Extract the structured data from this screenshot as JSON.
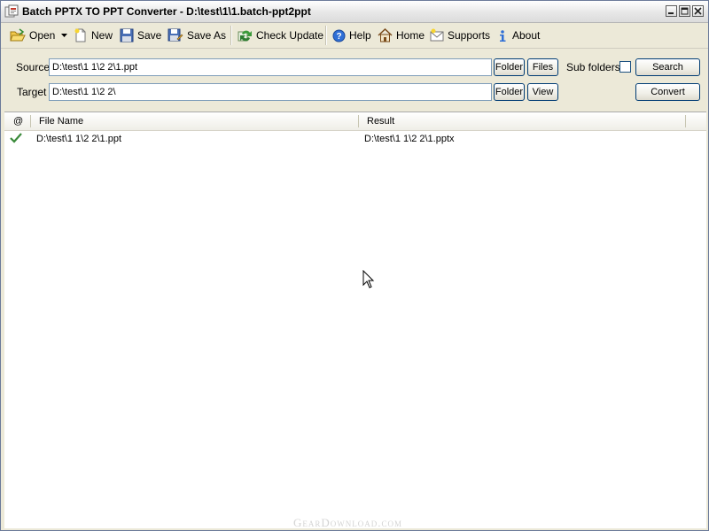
{
  "window": {
    "title": "Batch PPTX TO PPT Converter - D:\\test\\1\\1.batch-ppt2ppt"
  },
  "toolbar": {
    "open": "Open",
    "new": "New",
    "save": "Save",
    "save_as": "Save As",
    "check_update": "Check Update",
    "help": "Help",
    "home": "Home",
    "supports": "Supports",
    "about": "About"
  },
  "form": {
    "source_label": "Source",
    "source_value": "D:\\test\\1 1\\2 2\\1.ppt",
    "target_label": "Target",
    "target_value": "D:\\test\\1 1\\2 2\\",
    "folder_label": "Folder",
    "files_label": "Files",
    "view_label": "View",
    "subfolders_label": "Sub folders",
    "search_label": "Search",
    "convert_label": "Convert"
  },
  "list": {
    "columns": [
      "@",
      "File Name",
      "Result"
    ],
    "rows": [
      {
        "status_icon": "check-icon",
        "file_name": "D:\\test\\1 1\\2 2\\1.ppt",
        "result": "D:\\test\\1 1\\2 2\\1.pptx"
      }
    ]
  },
  "watermark": "GearDownload.com"
}
